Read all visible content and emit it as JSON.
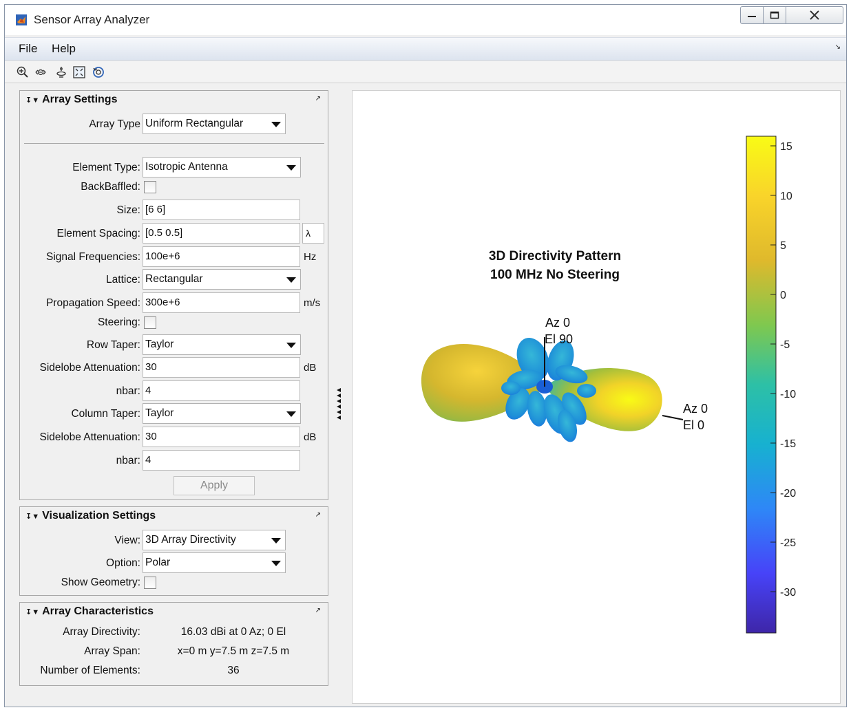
{
  "window": {
    "title": "Sensor Array Analyzer"
  },
  "menu": {
    "items": [
      "File",
      "Help"
    ]
  },
  "toolbar": {
    "tools": [
      "zoom-in-icon",
      "zoom-out-icon",
      "rotate-icon",
      "fit-icon",
      "reset-view-icon"
    ]
  },
  "array_settings": {
    "title": "Array Settings",
    "array_type": {
      "label": "Array Type",
      "value": "Uniform Rectangular"
    },
    "element_type": {
      "label": "Element Type:",
      "value": "Isotropic Antenna"
    },
    "backbaffled": {
      "label": "BackBaffled:",
      "checked": false
    },
    "size": {
      "label": "Size:",
      "value": "[6 6]"
    },
    "element_spacing": {
      "label": "Element Spacing:",
      "value": "[0.5 0.5]",
      "unit": "λ"
    },
    "signal_frequencies": {
      "label": "Signal Frequencies:",
      "value": "100e+6",
      "unit": "Hz"
    },
    "lattice": {
      "label": "Lattice:",
      "value": "Rectangular"
    },
    "propagation_speed": {
      "label": "Propagation Speed:",
      "value": "300e+6",
      "unit": "m/s"
    },
    "steering": {
      "label": "Steering:",
      "checked": false
    },
    "row_taper": {
      "label": "Row Taper:",
      "value": "Taylor"
    },
    "row_sidelobe": {
      "label": "Sidelobe Attenuation:",
      "value": "30",
      "unit": "dB"
    },
    "row_nbar": {
      "label": "nbar:",
      "value": "4"
    },
    "column_taper": {
      "label": "Column Taper:",
      "value": "Taylor"
    },
    "column_sidelobe": {
      "label": "Sidelobe Attenuation:",
      "value": "30",
      "unit": "dB"
    },
    "column_nbar": {
      "label": "nbar:",
      "value": "4"
    },
    "apply_label": "Apply"
  },
  "visualization_settings": {
    "title": "Visualization Settings",
    "view": {
      "label": "View:",
      "value": "3D Array Directivity"
    },
    "option": {
      "label": "Option:",
      "value": "Polar"
    },
    "show_geometry": {
      "label": "Show Geometry:",
      "checked": false
    }
  },
  "array_characteristics": {
    "title": "Array Characteristics",
    "directivity": {
      "label": "Array Directivity:",
      "value": "16.03 dBi at 0 Az; 0 El"
    },
    "span": {
      "label": "Array Span:",
      "value": "x=0 m y=7.5 m z=7.5 m"
    },
    "num_elements": {
      "label": "Number of Elements:",
      "value": "36"
    }
  },
  "plot": {
    "title_line1": "3D Directivity Pattern",
    "title_line2": "100 MHz No Steering",
    "annot_top": {
      "az": "Az 0",
      "el": "El 90"
    },
    "annot_right": {
      "az": "Az 0",
      "el": "El 0"
    },
    "colorbar_ticks": [
      "15",
      "10",
      "5",
      "0",
      "-5",
      "-10",
      "-15",
      "-20",
      "-25",
      "-30"
    ],
    "colormap": [
      "#3e26a8",
      "#4743f8",
      "#2e87f7",
      "#17b1d0",
      "#2dc0a6",
      "#7fc84f",
      "#dfb92c",
      "#f9d42a",
      "#f9fb15"
    ]
  }
}
